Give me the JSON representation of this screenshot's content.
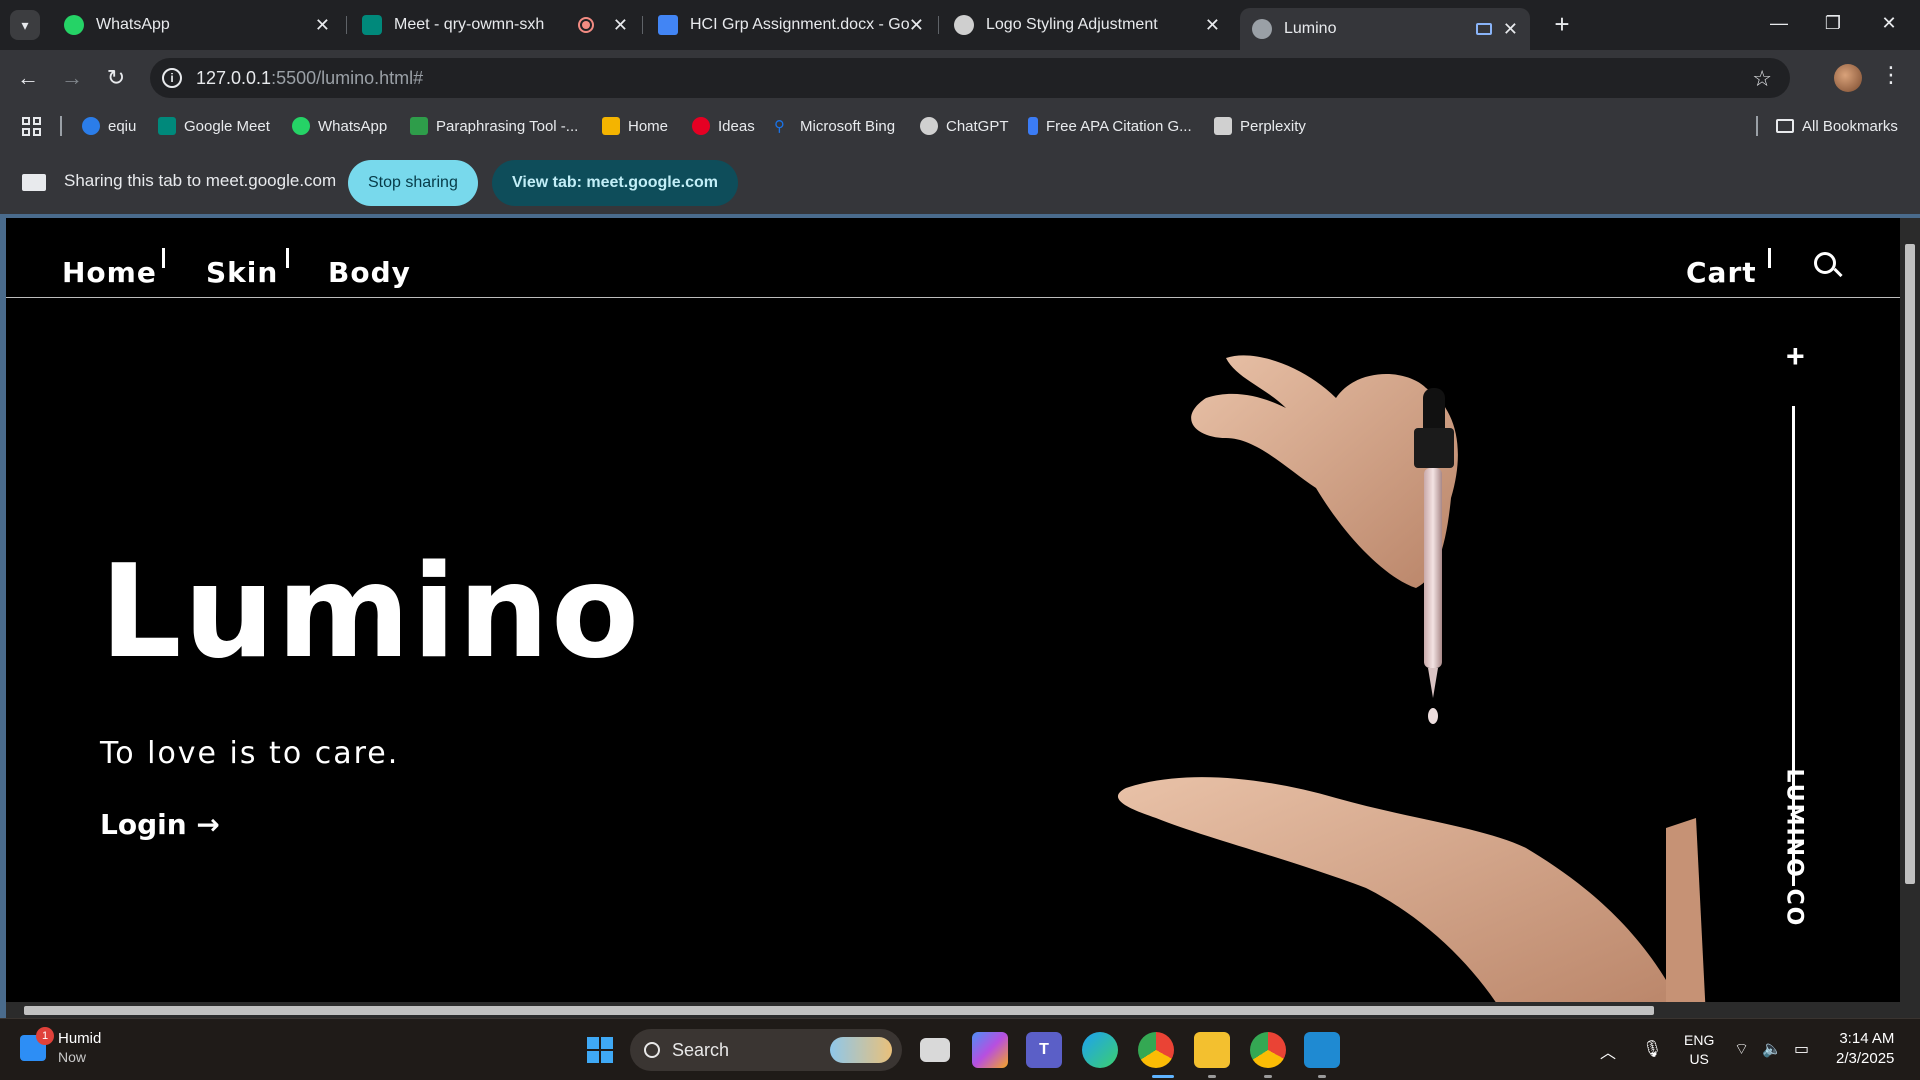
{
  "tabs": [
    {
      "title": "WhatsApp",
      "icon": "whatsapp-icon",
      "color": "#25D366"
    },
    {
      "title": "Meet - qry-owmn-sxh",
      "icon": "google-meet-icon",
      "color": "#00897B"
    },
    {
      "title": "HCI Grp Assignment.docx - Goo",
      "icon": "google-docs-icon",
      "color": "#4285F4"
    },
    {
      "title": "Logo Styling Adjustment",
      "icon": "chatgpt-icon",
      "color": "#cfcfcf"
    },
    {
      "title": "Lumino",
      "icon": "globe-icon",
      "color": "#9aa0a6"
    }
  ],
  "url": {
    "host": "127.0.0.1",
    "rest": ":5500/lumino.html#"
  },
  "bookmarks": [
    {
      "label": "eqiu",
      "color": "#2b7de9"
    },
    {
      "label": "Google Meet",
      "color": "#00897B"
    },
    {
      "label": "WhatsApp",
      "color": "#25D366"
    },
    {
      "label": "Paraphrasing Tool -...",
      "color": "#2e9d4a"
    },
    {
      "label": "Home",
      "color": "#f4b400"
    },
    {
      "label": "Ideas",
      "color": "#e60023"
    },
    {
      "label": "Microsoft Bing",
      "color": "#1a73e8"
    },
    {
      "label": "ChatGPT",
      "color": "#d0d0d0"
    },
    {
      "label": "Free APA Citation G...",
      "color": "#3b7cf5"
    },
    {
      "label": "Perplexity",
      "color": "#d0d0d0"
    }
  ],
  "all_bookmarks": "All Bookmarks",
  "sharing": {
    "text": "Sharing this tab to meet.google.com",
    "stop": "Stop sharing",
    "view": "View tab: meet.google.com"
  },
  "site": {
    "nav": [
      "Home",
      "Skin",
      "Body"
    ],
    "cart": "Cart",
    "title": "Lumino",
    "tagline": "To love is to care.",
    "login": "Login →",
    "plus": "+",
    "side_logo": "LUMINO CO"
  },
  "taskbar": {
    "weather_title": "Humid",
    "weather_sub": "Now",
    "badge": "1",
    "search": "Search",
    "lang_top": "ENG",
    "lang_bottom": "US",
    "time": "3:14 AM",
    "date": "2/3/2025"
  }
}
